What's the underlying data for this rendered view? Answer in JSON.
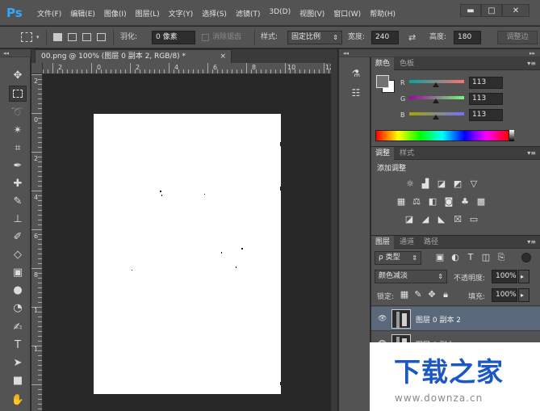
{
  "app": {
    "logo": "Ps"
  },
  "menu": [
    "文件(F)",
    "编辑(E)",
    "图像(I)",
    "图层(L)",
    "文字(Y)",
    "选择(S)",
    "滤镜(T)",
    "3D(D)",
    "视图(V)",
    "窗口(W)",
    "帮助(H)"
  ],
  "window_controls": {
    "minimize": "▬",
    "maximize": "□",
    "close": "✕"
  },
  "options_bar": {
    "feather_label": "羽化:",
    "feather_value": "0 像素",
    "antialias_label": "消除锯齿",
    "style_label": "样式:",
    "style_value": "固定比例",
    "width_label": "宽度:",
    "width_value": "240",
    "swap_icon": "⇄",
    "height_label": "高度:",
    "height_value": "180",
    "refine_edge": "调整边"
  },
  "document": {
    "tab_title": "00.png @ 100% (图层 0 副本 2, RGB/8) *",
    "close": "×",
    "hruler_labels": [
      "2",
      "0",
      "2",
      "4",
      "6",
      "8",
      "10",
      "12"
    ],
    "vruler_labels": [
      "2",
      "0",
      "2",
      "4",
      "6",
      "8",
      "1",
      "1"
    ]
  },
  "panel_grip": "◂◂",
  "color_panel": {
    "tabs": [
      "颜色",
      "色板"
    ],
    "channels": [
      {
        "label": "R",
        "value": "113"
      },
      {
        "label": "G",
        "value": "113"
      },
      {
        "label": "B",
        "value": "113"
      }
    ],
    "foreground_color": "#717171",
    "background_color": "#ffffff"
  },
  "adjustments_panel": {
    "tabs": [
      "调整",
      "样式"
    ],
    "add_label": "添加调整"
  },
  "layers_panel": {
    "tabs": [
      "图层",
      "通道",
      "路径"
    ],
    "filter_label": "ρ 类型",
    "blend_mode": "颜色减淡",
    "opacity_label": "不透明度:",
    "opacity_value": "100%",
    "lock_label": "锁定:",
    "fill_label": "填充:",
    "fill_value": "100%",
    "layers": [
      {
        "name": "图层 0 副本 2",
        "selected": true
      },
      {
        "name": "图层 0 副本",
        "selected": false
      }
    ]
  },
  "watermark": {
    "title": "下载之家",
    "url": "www.downza.cn"
  }
}
